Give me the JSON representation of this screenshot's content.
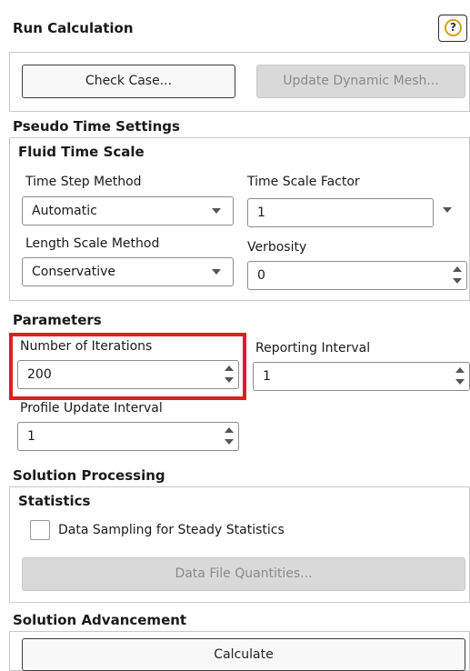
{
  "panel": {
    "title": "Run Calculation",
    "help_icon": "?"
  },
  "top_buttons": {
    "check_case": "Check Case...",
    "update_dynamic_mesh": "Update Dynamic Mesh..."
  },
  "pseudo_time": {
    "section": "Pseudo Time Settings",
    "group": "Fluid Time Scale",
    "time_step_method_label": "Time Step Method",
    "time_step_method_value": "Automatic",
    "time_scale_factor_label": "Time Scale Factor",
    "time_scale_factor_value": "1",
    "length_scale_method_label": "Length Scale Method",
    "length_scale_method_value": "Conservative",
    "verbosity_label": "Verbosity",
    "verbosity_value": "0"
  },
  "parameters": {
    "section": "Parameters",
    "iterations_label": "Number of Iterations",
    "iterations_value": "200",
    "reporting_interval_label": "Reporting Interval",
    "reporting_interval_value": "1",
    "profile_update_label": "Profile Update Interval",
    "profile_update_value": "1",
    "highlight_color": "#e01e1e"
  },
  "solution_processing": {
    "section": "Solution Processing",
    "group": "Statistics",
    "data_sampling_label": "Data Sampling for Steady Statistics",
    "data_sampling_checked": false,
    "data_file_quantities": "Data File Quantities..."
  },
  "solution_advancement": {
    "section": "Solution Advancement",
    "calculate": "Calculate"
  }
}
